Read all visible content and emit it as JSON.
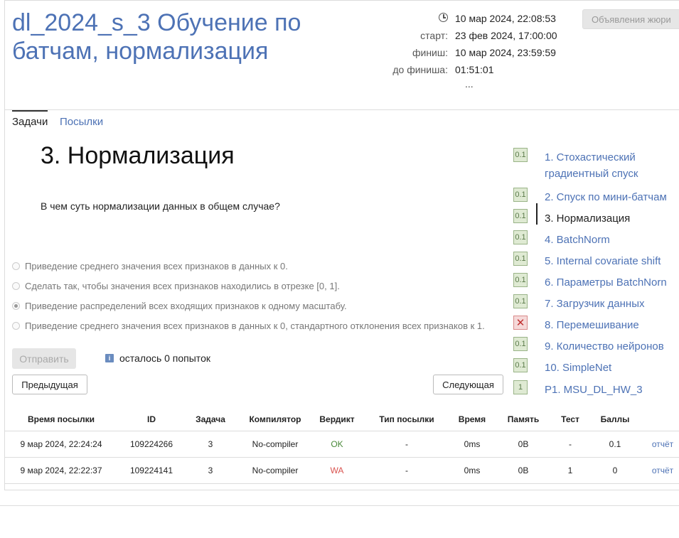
{
  "header": {
    "title": "dl_2024_s_3 Обучение по батчам, нормализация",
    "current_time": "10 мар 2024, 22:08:53",
    "start_label": "старт:",
    "start_value": "23 фев 2024, 17:00:00",
    "finish_label": "финиш:",
    "finish_value": "10 мар 2024, 23:59:59",
    "remaining_label": "до финиша:",
    "remaining_value": "01:51:01",
    "more": "...",
    "jury_button": "Объявления жюри"
  },
  "tabs": [
    {
      "label": "Задачи",
      "active": true
    },
    {
      "label": "Посылки",
      "active": false
    }
  ],
  "problem": {
    "title": "3. Нормализация",
    "question": "В чем суть нормализации данных в общем случае?",
    "options": [
      {
        "label": "Приведение среднего значения всех признаков в данных к 0.",
        "checked": false
      },
      {
        "label": "Сделать так, чтобы значения всех признаков находились в отрезке [0, 1].",
        "checked": false
      },
      {
        "label": "Приведение распределений всех входящих признаков к одному масштабу.",
        "checked": true
      },
      {
        "label": "Приведение среднего значения всех признаков в данных к 0, стандартного отклонения всех признаков к 1.",
        "checked": false
      }
    ],
    "submit_label": "Отправить",
    "info_icon": "i",
    "attempts_text": "осталось 0 попыток",
    "prev_label": "Предыдущая",
    "next_label": "Следующая"
  },
  "problem_list": [
    {
      "badge": "0.1",
      "label": "1. Стохастический градиентный спуск",
      "status": "ok"
    },
    {
      "badge": "0.1",
      "label": "2. Спуск по мини-батчам",
      "status": "ok"
    },
    {
      "badge": "0.1",
      "label": "3. Нормализация",
      "status": "ok",
      "current": true
    },
    {
      "badge": "0.1",
      "label": "4. BatchNorm",
      "status": "ok"
    },
    {
      "badge": "0.1",
      "label": "5. Internal covariate shift",
      "status": "ok"
    },
    {
      "badge": "0.1",
      "label": "6. Параметры BatchNorn",
      "status": "ok"
    },
    {
      "badge": "0.1",
      "label": "7. Загрузчик данных",
      "status": "ok"
    },
    {
      "badge": "✕",
      "label": "8. Перемешивание",
      "status": "fail"
    },
    {
      "badge": "0.1",
      "label": "9. Количество нейронов",
      "status": "ok"
    },
    {
      "badge": "0.1",
      "label": "10. SimpleNet",
      "status": "ok"
    },
    {
      "badge": "1",
      "label": "P1. MSU_DL_HW_3",
      "status": "ok"
    }
  ],
  "submissions": {
    "headers": [
      "Время посылки",
      "ID",
      "Задача",
      "Компилятор",
      "Вердикт",
      "Тип посылки",
      "Время",
      "Память",
      "Тест",
      "Баллы",
      ""
    ],
    "rows": [
      [
        "9 мар 2024, 22:24:24",
        "109224266",
        "3",
        "No-compiler",
        "OK",
        "-",
        "0ms",
        "0B",
        "-",
        "0.1",
        "отчёт"
      ],
      [
        "9 мар 2024, 22:22:37",
        "109224141",
        "3",
        "No-compiler",
        "WA",
        "-",
        "0ms",
        "0B",
        "1",
        "0",
        "отчёт"
      ]
    ]
  }
}
